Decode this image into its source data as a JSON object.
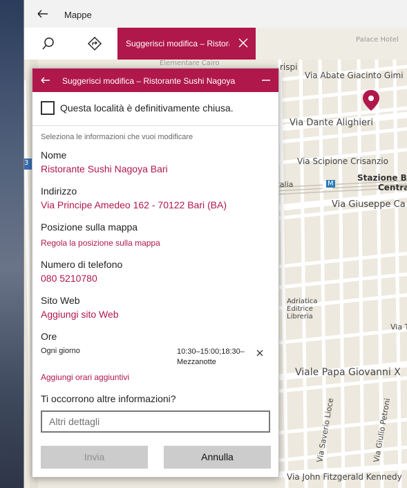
{
  "window": {
    "title": "Mappe"
  },
  "toolbar": {
    "search_icon": "search-icon",
    "directions_icon": "directions-icon"
  },
  "tab": {
    "label": "Suggerisci modifica – Ristorante Sushi Nagoya"
  },
  "map": {
    "labels": {
      "palace_hotel": "Palace Hotel",
      "elementare": "Elementare Cairo",
      "crispi": "rispi",
      "via_abate": "Via Abate Giacinto Gimi",
      "via_dante": "Via Dante Alighieri",
      "via_scipione": "Via Scipione Crisanzio",
      "corso_italia": "orso Italia",
      "stazione": "Stazione Ba",
      "centrale": "Centra",
      "via_giuseppe": "Via Giuseppe Ca",
      "adriatica": "Adriatica Editrice Libreria",
      "via_papa": "Viale Papa Giovanni X",
      "via_saverio": "Via Saverio Lioce",
      "via_giulio": "Via Giulio Petroni",
      "via_fitzgerald": "Via John Fitzgerald Kennedy",
      "via_ti": "Via Ti",
      "route_number": "3",
      "metro": "M"
    },
    "pin_color": "#b0174a"
  },
  "dialog": {
    "title": "Suggerisci modifica – Ristorante Sushi Nagoya",
    "closed_checkbox_label": "Questa località è definitivamente chiusa.",
    "closed_checked": false,
    "hint": "Seleziona le informazioni che vuoi modificare",
    "name_label": "Nome",
    "name_value": "Ristorante Sushi Nagoya Bari",
    "address_label": "Indirizzo",
    "address_value": "Via Principe Amedeo 162 - 70122 Bari (BA)",
    "position_label": "Posizione sulla mappa",
    "position_link": "Regola la posizione sulla mappa",
    "phone_label": "Numero di telefono",
    "phone_value": "080 5210780",
    "website_label": "Sito Web",
    "website_value": "Aggiungi sito Web",
    "hours_label": "Ore",
    "hours_day": "Ogni giorno",
    "hours_time": "10:30–15:00;18:30–Mezzanotte",
    "add_hours_link": "Aggiungi orari aggiuntivi",
    "more_info_label": "Ti occorrono altre informazioni?",
    "details_placeholder": "Altri dettagli",
    "details_value": "",
    "send_button": "Invia",
    "cancel_button": "Annulla"
  },
  "colors": {
    "accent": "#b0174a",
    "map_bg": "#ede9df",
    "road": "#ffffff"
  }
}
